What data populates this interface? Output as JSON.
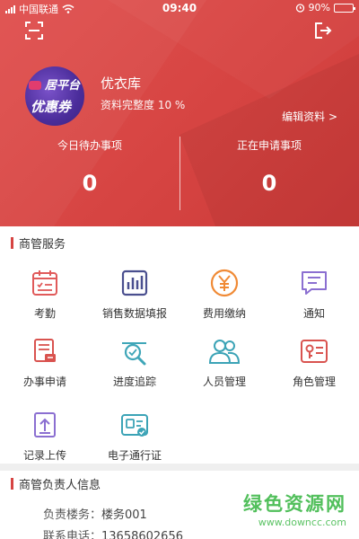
{
  "status_bar": {
    "carrier": "中国联通",
    "time": "09:40",
    "battery": "90%"
  },
  "profile": {
    "name": "优衣库",
    "completeness": "资料完整度 10 %",
    "edit_link": "编辑资料 >",
    "avatar_text_top": "居平台",
    "avatar_text_bottom": "优惠券"
  },
  "stats": {
    "left_label": "今日待办事项",
    "left_value": "0",
    "right_label": "正在申请事项",
    "right_value": "0"
  },
  "services": {
    "title": "商管服务",
    "items": [
      {
        "label": "考勤",
        "icon": "attendance-calendar-icon",
        "color": "#e05a5a"
      },
      {
        "label": "销售数据填报",
        "icon": "sales-chart-icon",
        "color": "#4a4f8f"
      },
      {
        "label": "费用缴纳",
        "icon": "yuan-coin-icon",
        "color": "#f08a35"
      },
      {
        "label": "通知",
        "icon": "message-icon",
        "color": "#8b6fd1"
      },
      {
        "label": "办事申请",
        "icon": "application-form-icon",
        "color": "#d9534f"
      },
      {
        "label": "进度追踪",
        "icon": "magnifier-progress-icon",
        "color": "#3fa6b8"
      },
      {
        "label": "人员管理",
        "icon": "people-icon",
        "color": "#3ba3b6"
      },
      {
        "label": "角色管理",
        "icon": "role-card-icon",
        "color": "#d9534f"
      },
      {
        "label": "记录上传",
        "icon": "upload-icon",
        "color": "#8b6fd1"
      },
      {
        "label": "电子通行证",
        "icon": "id-pass-icon",
        "color": "#3ba3b6"
      }
    ]
  },
  "manager_info": {
    "title": "商管负责人信息",
    "rows": [
      {
        "key": "负责楼务：",
        "value": "楼务001"
      },
      {
        "key": "联系电话：",
        "value": "13658602656"
      }
    ]
  },
  "watermark": {
    "main": "绿色资源网",
    "url": "www.downcc.com"
  }
}
